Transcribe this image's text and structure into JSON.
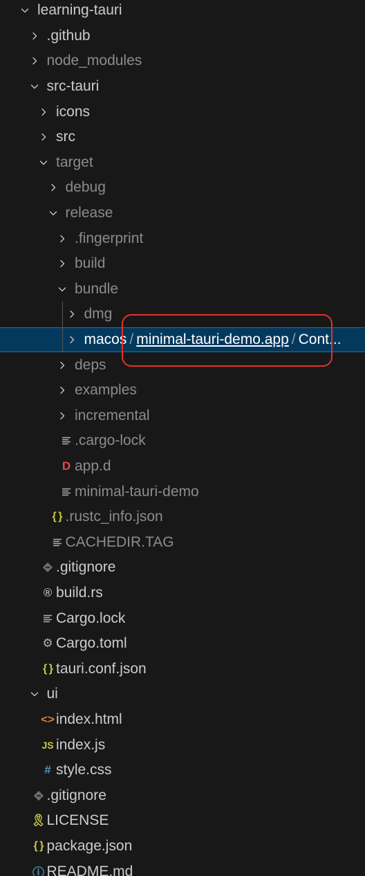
{
  "explorer": {
    "items": [
      {
        "label": "learning-tauri",
        "kind": "folder",
        "open": true,
        "depth": 0
      },
      {
        "label": ".github",
        "kind": "folder",
        "open": false,
        "depth": 1
      },
      {
        "label": "node_modules",
        "kind": "folder",
        "open": false,
        "depth": 1,
        "dim": true
      },
      {
        "label": "src-tauri",
        "kind": "folder",
        "open": true,
        "depth": 1
      },
      {
        "label": "icons",
        "kind": "folder",
        "open": false,
        "depth": 2
      },
      {
        "label": "src",
        "kind": "folder",
        "open": false,
        "depth": 2
      },
      {
        "label": "target",
        "kind": "folder",
        "open": true,
        "depth": 2,
        "dim": true
      },
      {
        "label": "debug",
        "kind": "folder",
        "open": false,
        "depth": 3,
        "dim": true
      },
      {
        "label": "release",
        "kind": "folder",
        "open": true,
        "depth": 3,
        "dim": true
      },
      {
        "label": ".fingerprint",
        "kind": "folder",
        "open": false,
        "depth": 4,
        "dim": true
      },
      {
        "label": "build",
        "kind": "folder",
        "open": false,
        "depth": 4,
        "dim": true
      },
      {
        "label": "bundle",
        "kind": "folder",
        "open": true,
        "depth": 4,
        "dim": true
      },
      {
        "label": "dmg",
        "kind": "folder",
        "open": false,
        "depth": 5,
        "dim": true
      },
      {
        "kind": "compact-folder",
        "open": false,
        "depth": 5,
        "selected": true,
        "segments": [
          "macos",
          "minimal-tauri-demo.app",
          "Cont..."
        ]
      },
      {
        "label": "deps",
        "kind": "folder",
        "open": false,
        "depth": 4,
        "dim": true
      },
      {
        "label": "examples",
        "kind": "folder",
        "open": false,
        "depth": 4,
        "dim": true
      },
      {
        "label": "incremental",
        "kind": "folder",
        "open": false,
        "depth": 4,
        "dim": true
      },
      {
        "label": ".cargo-lock",
        "kind": "file",
        "icon": "lines-icon",
        "depth": 4,
        "dim": true
      },
      {
        "label": "app.d",
        "kind": "file",
        "icon": "d-letter-icon",
        "icon_glyph": "D",
        "icon_color": "#e5484d",
        "depth": 4,
        "dim": true
      },
      {
        "label": "minimal-tauri-demo",
        "kind": "file",
        "icon": "lines-icon",
        "depth": 4,
        "dim": true
      },
      {
        "label": ".rustc_info.json",
        "kind": "file",
        "icon": "braces-icon",
        "icon_glyph": "{ }",
        "icon_color": "#cbcb41",
        "depth": 3,
        "dim": true
      },
      {
        "label": "CACHEDIR.TAG",
        "kind": "file",
        "icon": "lines-icon",
        "depth": 3,
        "dim": true
      },
      {
        "label": ".gitignore",
        "kind": "file",
        "icon": "git-icon",
        "depth": 2
      },
      {
        "label": "build.rs",
        "kind": "file",
        "icon": "rust-icon",
        "icon_glyph": "®",
        "icon_color": "#b0b0b0",
        "depth": 2
      },
      {
        "label": "Cargo.lock",
        "kind": "file",
        "icon": "lines-icon",
        "depth": 2
      },
      {
        "label": "Cargo.toml",
        "kind": "file",
        "icon": "gear-icon",
        "icon_glyph": "⚙",
        "icon_color": "#b0b0b0",
        "depth": 2
      },
      {
        "label": "tauri.conf.json",
        "kind": "file",
        "icon": "braces-icon",
        "icon_glyph": "{ }",
        "icon_color": "#cbcb41",
        "depth": 2
      },
      {
        "label": "ui",
        "kind": "folder",
        "open": true,
        "depth": 1
      },
      {
        "label": "index.html",
        "kind": "file",
        "icon": "html-icon",
        "icon_glyph": "<>",
        "icon_color": "#e37933",
        "depth": 2
      },
      {
        "label": "index.js",
        "kind": "file",
        "icon": "js-icon",
        "icon_glyph": "JS",
        "icon_color": "#cbcb41",
        "depth": 2
      },
      {
        "label": "style.css",
        "kind": "file",
        "icon": "hash-icon",
        "icon_glyph": "#",
        "icon_color": "#519aba",
        "depth": 2
      },
      {
        "label": ".gitignore",
        "kind": "file",
        "icon": "git-icon",
        "depth": 1
      },
      {
        "label": "LICENSE",
        "kind": "file",
        "icon": "license-icon",
        "icon_glyph": "🎗",
        "icon_color": "#cbcb41",
        "depth": 1
      },
      {
        "label": "package.json",
        "kind": "file",
        "icon": "braces-icon",
        "icon_glyph": "{ }",
        "icon_color": "#cbcb41",
        "depth": 1
      },
      {
        "label": "README.md",
        "kind": "file",
        "icon": "info-icon",
        "icon_glyph": "ⓘ",
        "icon_color": "#519aba",
        "depth": 1
      }
    ]
  },
  "colors": {
    "background": "#181818",
    "text": "#cccccc",
    "dim_text": "#8c8c8c",
    "selection_bg": "#04395e",
    "selection_border": "#0078d4",
    "annotation": "#e5312b"
  }
}
